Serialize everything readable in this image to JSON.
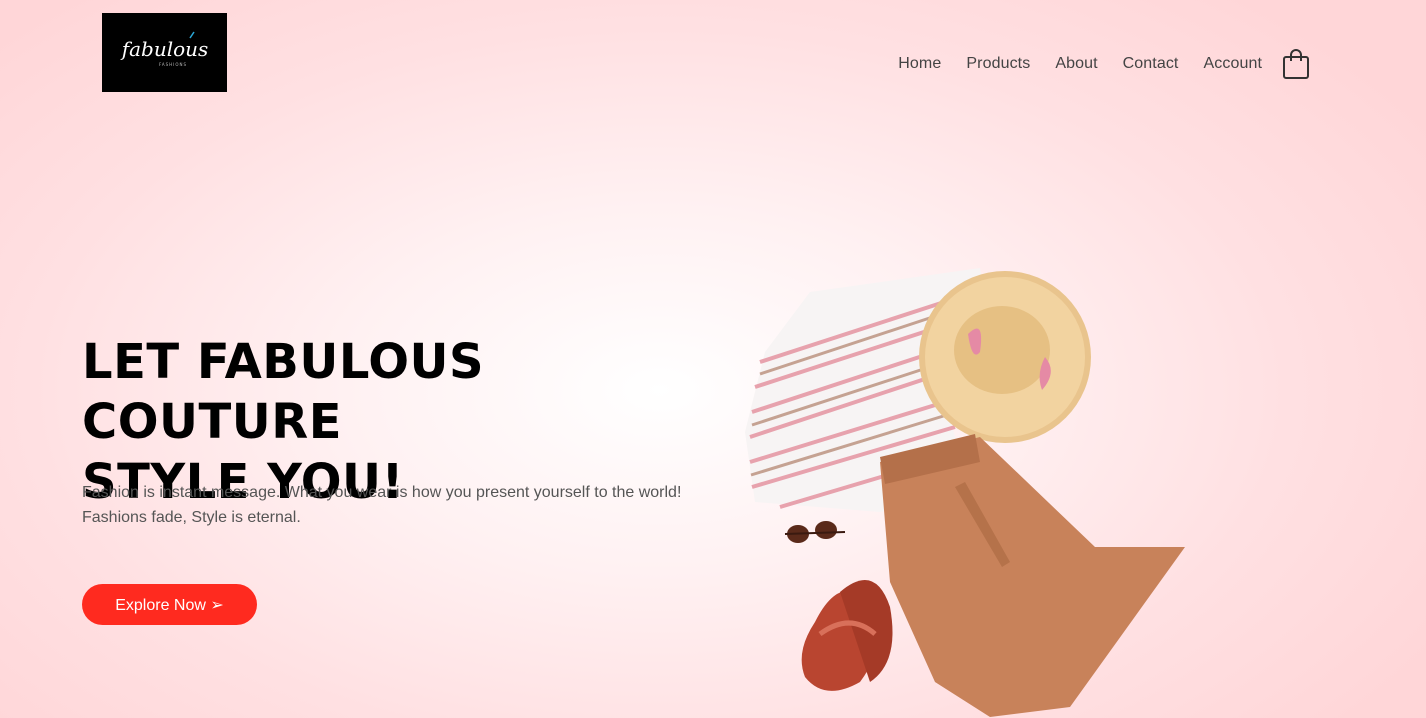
{
  "brand": {
    "logo_text": "fabulous",
    "logo_subtext": "FASHIONS",
    "logo_bg": "#000000"
  },
  "nav": {
    "items": [
      {
        "label": "Home"
      },
      {
        "label": "Products"
      },
      {
        "label": "About"
      },
      {
        "label": "Contact"
      },
      {
        "label": "Account"
      }
    ],
    "cart_icon": "shopping-bag-icon"
  },
  "hero": {
    "title_line1": "LET FABULOUS COUTURE",
    "title_line2": "STYLE YOU!",
    "text_line1": "Fashion is instant message. What you wear is how you present yourself to the world!",
    "text_line2": "Fashions fade, Style is eternal.",
    "cta_label": "Explore Now ➢",
    "accent_color": "#ff2a1f"
  }
}
